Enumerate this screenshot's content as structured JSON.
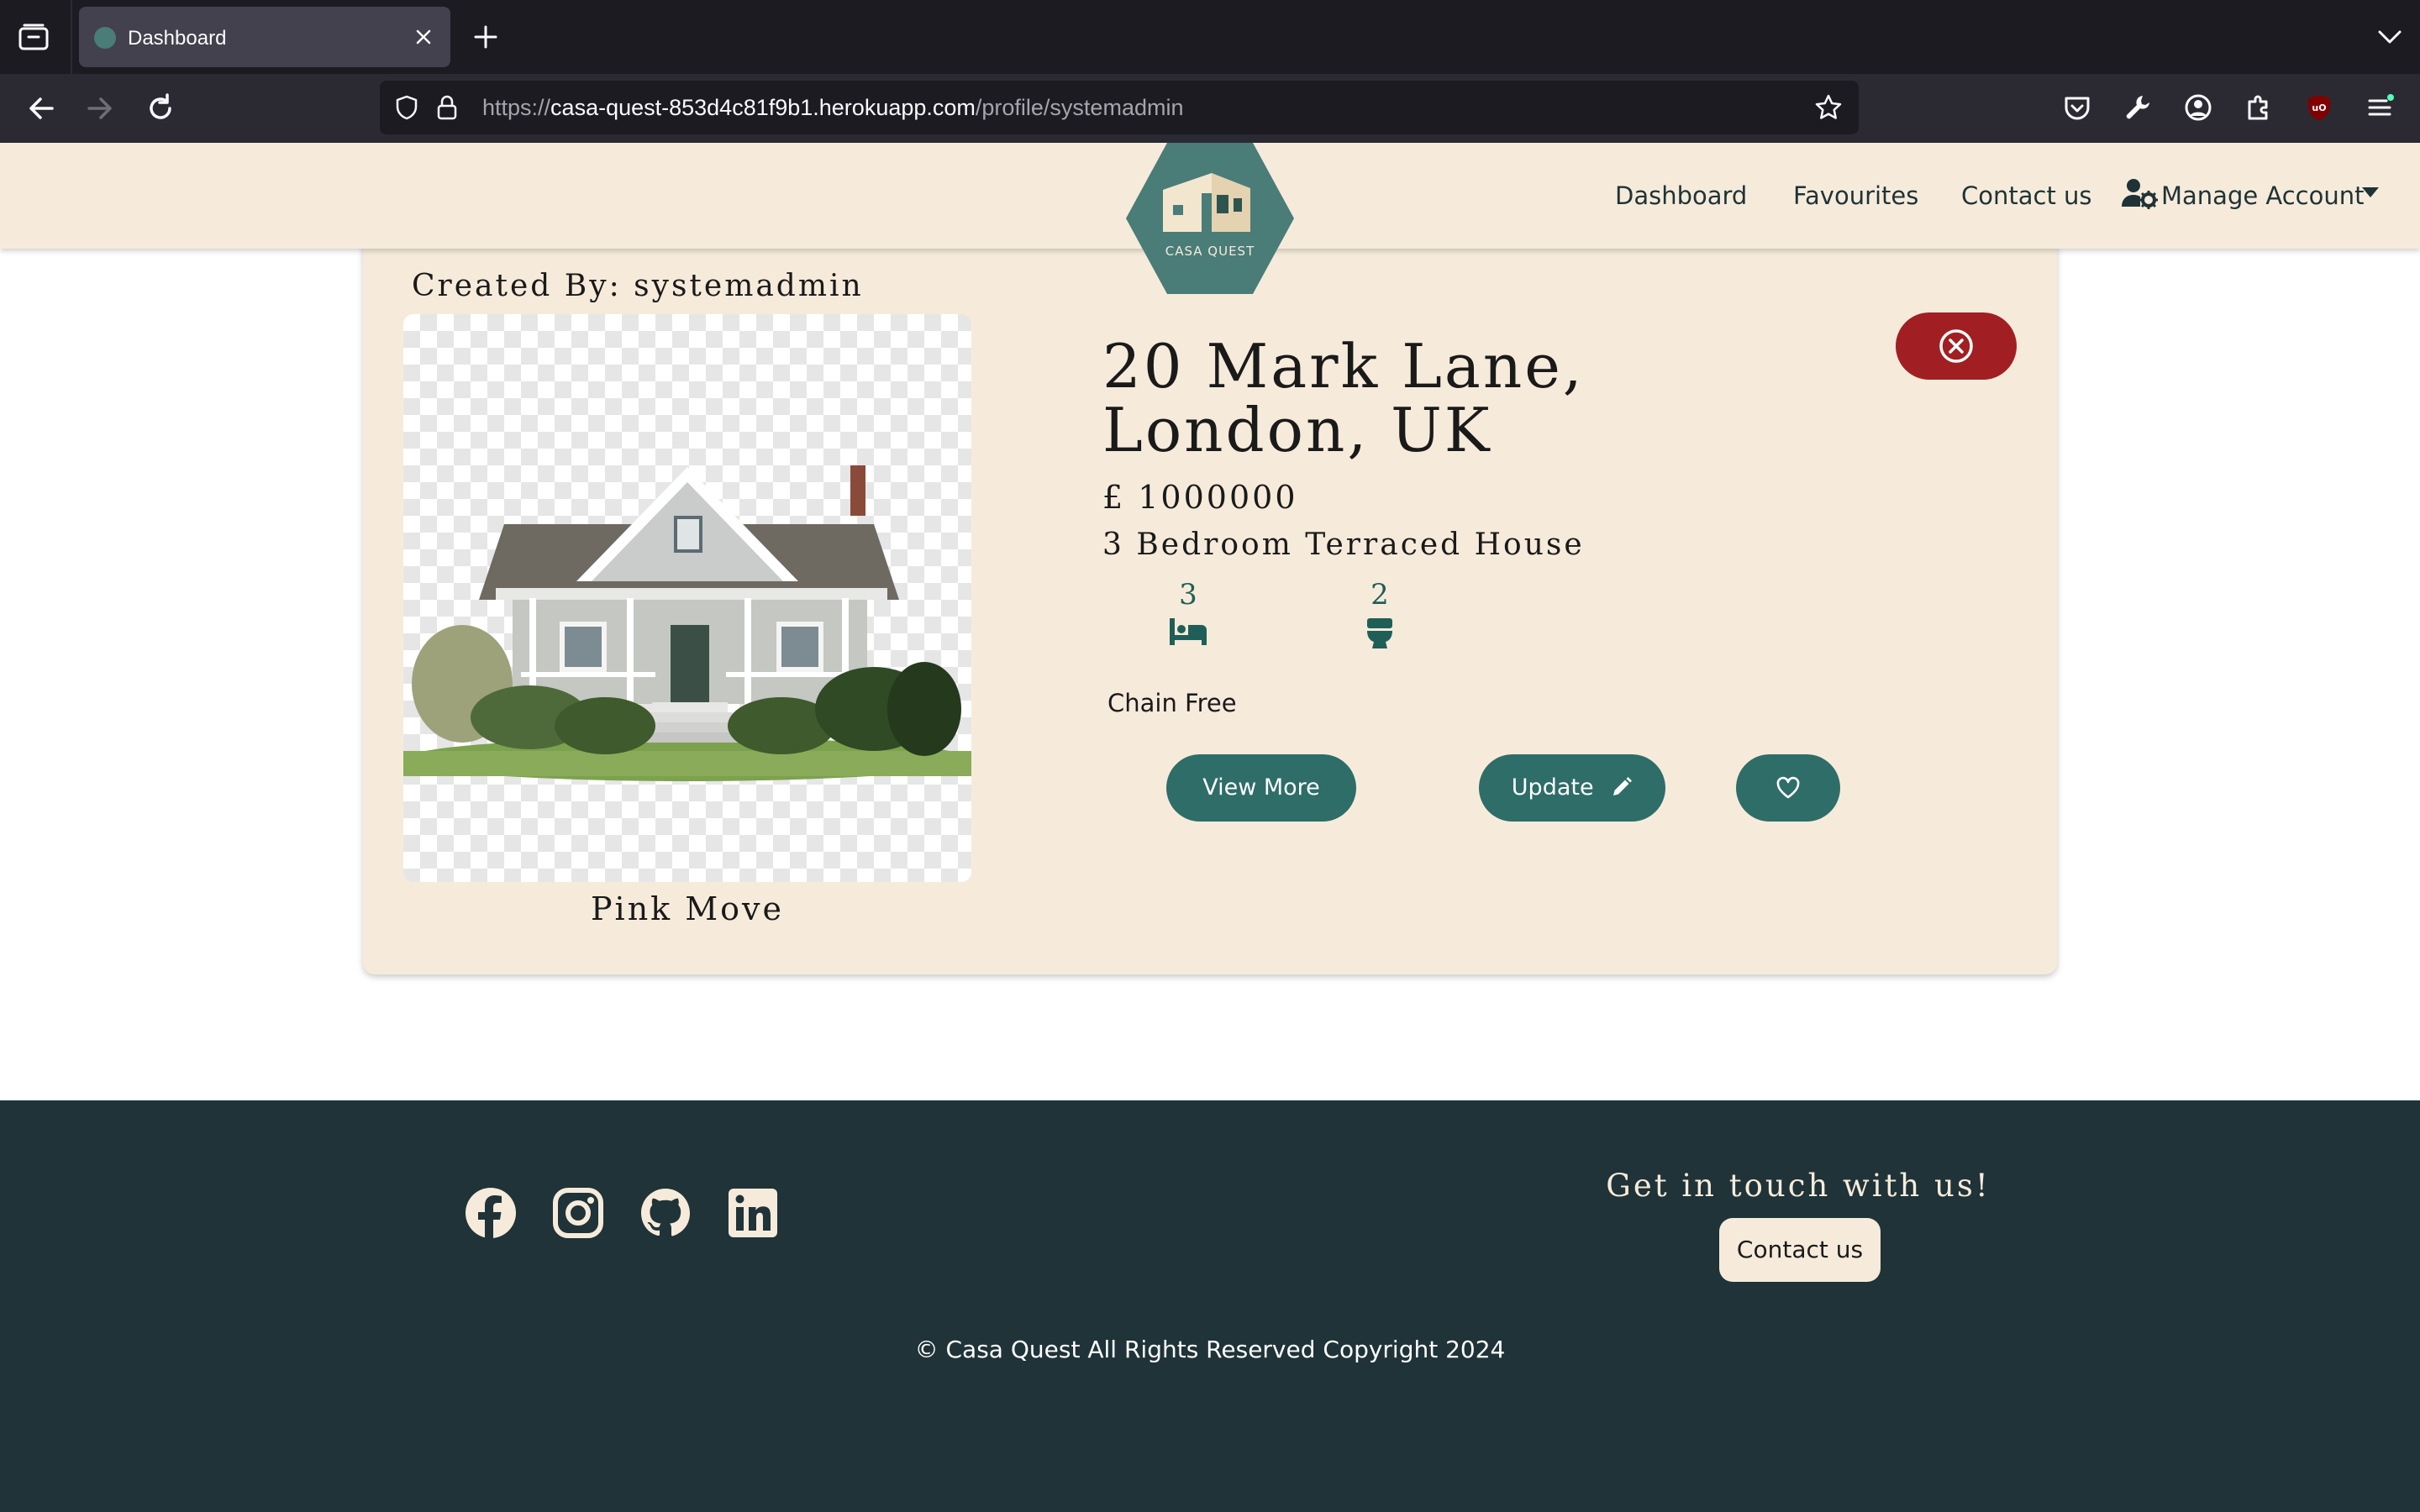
{
  "browser": {
    "tab": {
      "title": "Dashboard"
    },
    "url": {
      "prefix": "https://",
      "host": "casa-quest-853d4c81f9b1.herokuapp.com",
      "path": "/profile/systemadmin"
    },
    "icons": [
      "tab-overview-icon",
      "close-icon",
      "plus-icon",
      "chevron-down-icon",
      "back-arrow-icon",
      "forward-arrow-icon",
      "reload-icon",
      "shield-icon",
      "lock-icon",
      "star-icon",
      "pocket-icon",
      "wrench-icon",
      "account-icon",
      "extensions-icon",
      "ublock-icon",
      "menu-icon"
    ]
  },
  "header": {
    "logo_text": "CASA QUEST",
    "nav": {
      "dashboard": "Dashboard",
      "favourites": "Favourites",
      "contact": "Contact us",
      "manage": "Manage Account"
    },
    "icons": [
      "user-gear-icon",
      "caret-down-icon"
    ]
  },
  "property": {
    "created_by": "Created By: systemadmin",
    "photo_caption": "Pink Move",
    "address": "20 Mark Lane, London, UK",
    "price": "£ 1000000",
    "type": "3 Bedroom Terraced House",
    "bedrooms": "3",
    "bathrooms": "2",
    "chain": "Chain Free",
    "buttons": {
      "view_more": "View More",
      "update": "Update"
    },
    "icons": [
      "bed-icon",
      "toilet-icon",
      "pencil-icon",
      "heart-icon",
      "circle-x-icon"
    ]
  },
  "footer": {
    "get_in_touch": "Get in touch with us!",
    "contact_button": "Contact us",
    "copyright": "© Casa Quest All Rights Reserved Copyright 2024",
    "icons": [
      "facebook-icon",
      "instagram-icon",
      "github-icon",
      "linkedin-icon"
    ]
  },
  "colors": {
    "cream": "#f6ebdb",
    "teal": "#2e6d68",
    "dark_teal": "#1f3338",
    "danger": "#a11f22",
    "logo": "#4a7c78"
  }
}
